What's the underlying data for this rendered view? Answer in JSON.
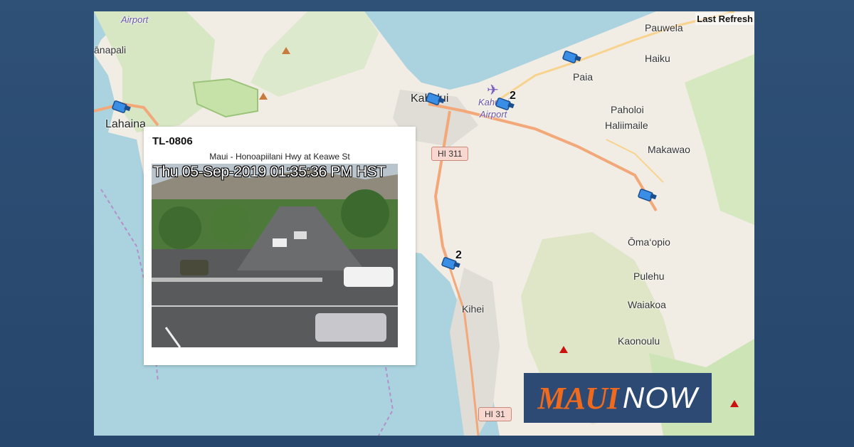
{
  "map": {
    "last_refresh_label": "Last Refresh",
    "places": {
      "airport_west": "Airport",
      "kaanapali": "ānapali",
      "lahaina": "Lahaina",
      "kahului": "Kahului",
      "kahului_airport_line1": "Kahului",
      "kahului_airport_line2": "Airport",
      "pauwela": "Pauwela",
      "haiku": "Haiku",
      "paia": "Paia",
      "paholoi": "Paholoi",
      "haliimaile": "Haliimaile",
      "makawao": "Makawao",
      "omaopio": "Ōma‘opio",
      "pulehu": "Pulehu",
      "waiakoa": "Waiakoa",
      "kaonoulu": "Kaonoulu",
      "kihei": "Kihei"
    },
    "shields": {
      "hi311": "HI 311",
      "hi31": "HI 31"
    },
    "camera_counts": {
      "kahului_airport": "2",
      "kihei": "2"
    },
    "colors": {
      "water": "#aad3df",
      "land": "#f1ede4",
      "green": "#cde8b0",
      "road": "#f3a87a"
    }
  },
  "popup": {
    "camera_id": "TL-0806",
    "location": "Maui - Honoapiilani Hwy at Keawe St",
    "timestamp": "Thu 05-Sep-2019 01:35:36 PM HST"
  },
  "brand": {
    "part1": "MAUI",
    "part2": "NOW"
  }
}
